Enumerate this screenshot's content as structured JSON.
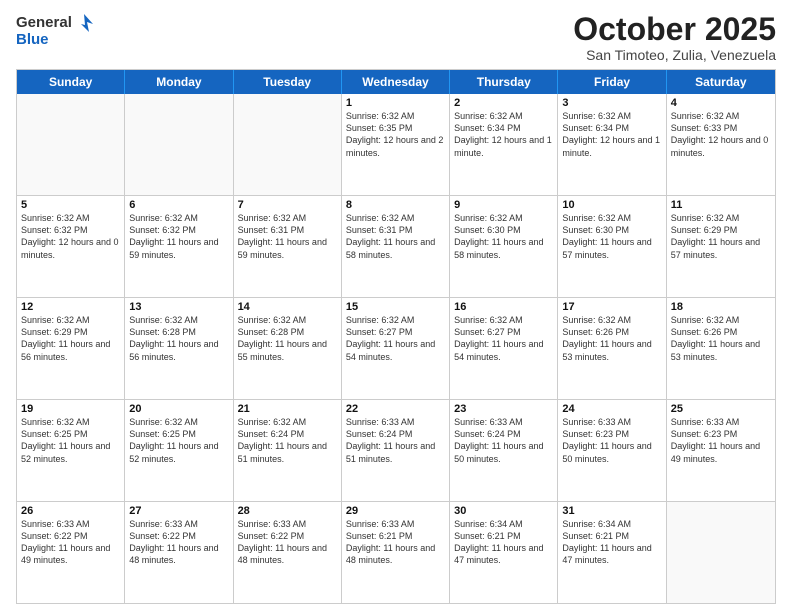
{
  "header": {
    "logo_general": "General",
    "logo_blue": "Blue",
    "month_title": "October 2025",
    "subtitle": "San Timoteo, Zulia, Venezuela"
  },
  "weekdays": [
    "Sunday",
    "Monday",
    "Tuesday",
    "Wednesday",
    "Thursday",
    "Friday",
    "Saturday"
  ],
  "weeks": [
    [
      {
        "day": "",
        "info": "",
        "empty": true
      },
      {
        "day": "",
        "info": "",
        "empty": true
      },
      {
        "day": "",
        "info": "",
        "empty": true
      },
      {
        "day": "1",
        "info": "Sunrise: 6:32 AM\nSunset: 6:35 PM\nDaylight: 12 hours\nand 2 minutes."
      },
      {
        "day": "2",
        "info": "Sunrise: 6:32 AM\nSunset: 6:34 PM\nDaylight: 12 hours\nand 1 minute."
      },
      {
        "day": "3",
        "info": "Sunrise: 6:32 AM\nSunset: 6:34 PM\nDaylight: 12 hours\nand 1 minute."
      },
      {
        "day": "4",
        "info": "Sunrise: 6:32 AM\nSunset: 6:33 PM\nDaylight: 12 hours\nand 0 minutes."
      }
    ],
    [
      {
        "day": "5",
        "info": "Sunrise: 6:32 AM\nSunset: 6:32 PM\nDaylight: 12 hours\nand 0 minutes."
      },
      {
        "day": "6",
        "info": "Sunrise: 6:32 AM\nSunset: 6:32 PM\nDaylight: 11 hours\nand 59 minutes."
      },
      {
        "day": "7",
        "info": "Sunrise: 6:32 AM\nSunset: 6:31 PM\nDaylight: 11 hours\nand 59 minutes."
      },
      {
        "day": "8",
        "info": "Sunrise: 6:32 AM\nSunset: 6:31 PM\nDaylight: 11 hours\nand 58 minutes."
      },
      {
        "day": "9",
        "info": "Sunrise: 6:32 AM\nSunset: 6:30 PM\nDaylight: 11 hours\nand 58 minutes."
      },
      {
        "day": "10",
        "info": "Sunrise: 6:32 AM\nSunset: 6:30 PM\nDaylight: 11 hours\nand 57 minutes."
      },
      {
        "day": "11",
        "info": "Sunrise: 6:32 AM\nSunset: 6:29 PM\nDaylight: 11 hours\nand 57 minutes."
      }
    ],
    [
      {
        "day": "12",
        "info": "Sunrise: 6:32 AM\nSunset: 6:29 PM\nDaylight: 11 hours\nand 56 minutes."
      },
      {
        "day": "13",
        "info": "Sunrise: 6:32 AM\nSunset: 6:28 PM\nDaylight: 11 hours\nand 56 minutes."
      },
      {
        "day": "14",
        "info": "Sunrise: 6:32 AM\nSunset: 6:28 PM\nDaylight: 11 hours\nand 55 minutes."
      },
      {
        "day": "15",
        "info": "Sunrise: 6:32 AM\nSunset: 6:27 PM\nDaylight: 11 hours\nand 54 minutes."
      },
      {
        "day": "16",
        "info": "Sunrise: 6:32 AM\nSunset: 6:27 PM\nDaylight: 11 hours\nand 54 minutes."
      },
      {
        "day": "17",
        "info": "Sunrise: 6:32 AM\nSunset: 6:26 PM\nDaylight: 11 hours\nand 53 minutes."
      },
      {
        "day": "18",
        "info": "Sunrise: 6:32 AM\nSunset: 6:26 PM\nDaylight: 11 hours\nand 53 minutes."
      }
    ],
    [
      {
        "day": "19",
        "info": "Sunrise: 6:32 AM\nSunset: 6:25 PM\nDaylight: 11 hours\nand 52 minutes."
      },
      {
        "day": "20",
        "info": "Sunrise: 6:32 AM\nSunset: 6:25 PM\nDaylight: 11 hours\nand 52 minutes."
      },
      {
        "day": "21",
        "info": "Sunrise: 6:32 AM\nSunset: 6:24 PM\nDaylight: 11 hours\nand 51 minutes."
      },
      {
        "day": "22",
        "info": "Sunrise: 6:33 AM\nSunset: 6:24 PM\nDaylight: 11 hours\nand 51 minutes."
      },
      {
        "day": "23",
        "info": "Sunrise: 6:33 AM\nSunset: 6:24 PM\nDaylight: 11 hours\nand 50 minutes."
      },
      {
        "day": "24",
        "info": "Sunrise: 6:33 AM\nSunset: 6:23 PM\nDaylight: 11 hours\nand 50 minutes."
      },
      {
        "day": "25",
        "info": "Sunrise: 6:33 AM\nSunset: 6:23 PM\nDaylight: 11 hours\nand 49 minutes."
      }
    ],
    [
      {
        "day": "26",
        "info": "Sunrise: 6:33 AM\nSunset: 6:22 PM\nDaylight: 11 hours\nand 49 minutes."
      },
      {
        "day": "27",
        "info": "Sunrise: 6:33 AM\nSunset: 6:22 PM\nDaylight: 11 hours\nand 48 minutes."
      },
      {
        "day": "28",
        "info": "Sunrise: 6:33 AM\nSunset: 6:22 PM\nDaylight: 11 hours\nand 48 minutes."
      },
      {
        "day": "29",
        "info": "Sunrise: 6:33 AM\nSunset: 6:21 PM\nDaylight: 11 hours\nand 48 minutes."
      },
      {
        "day": "30",
        "info": "Sunrise: 6:34 AM\nSunset: 6:21 PM\nDaylight: 11 hours\nand 47 minutes."
      },
      {
        "day": "31",
        "info": "Sunrise: 6:34 AM\nSunset: 6:21 PM\nDaylight: 11 hours\nand 47 minutes."
      },
      {
        "day": "",
        "info": "",
        "empty": true
      }
    ]
  ]
}
